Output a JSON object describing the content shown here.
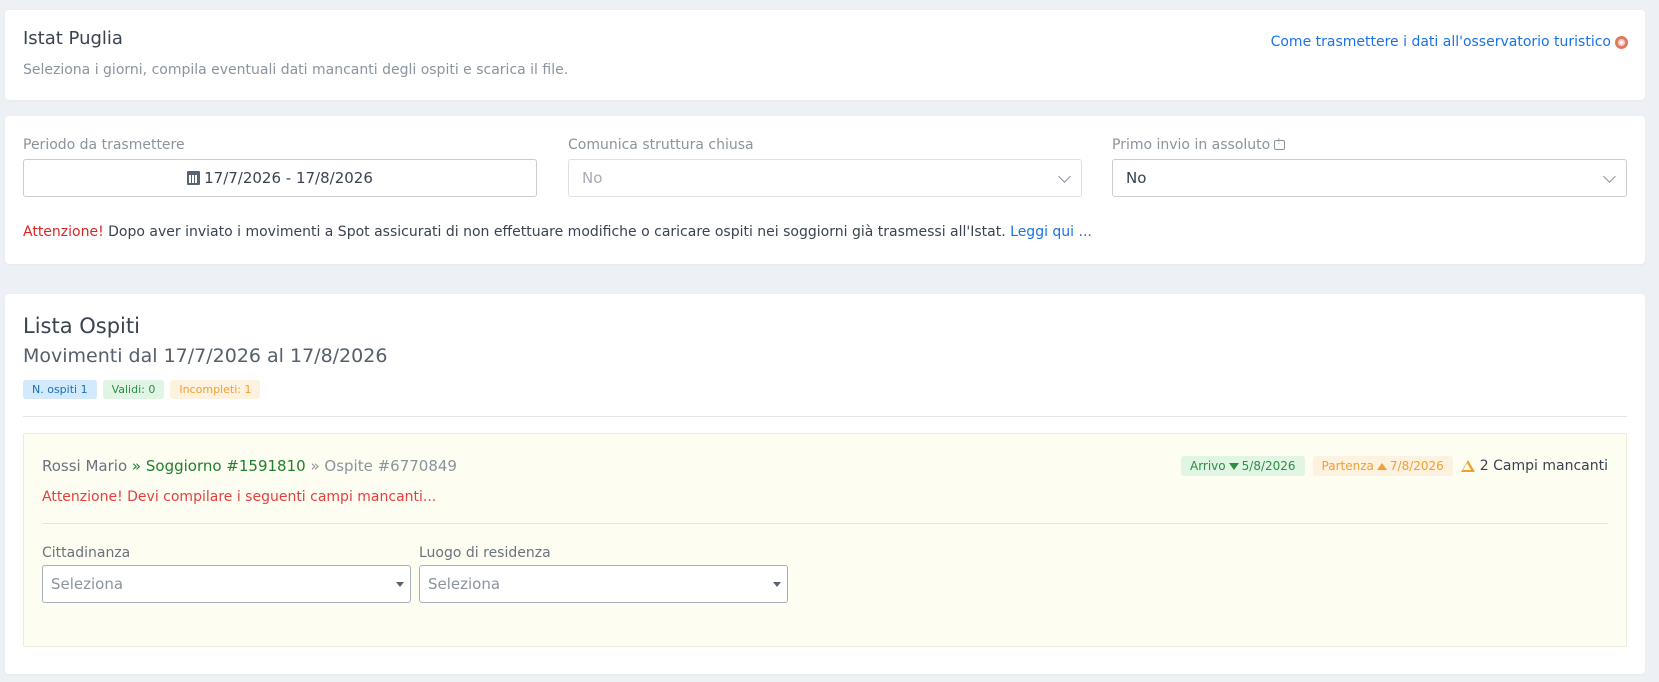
{
  "header": {
    "title": "Istat Puglia",
    "subtitle": "Seleziona i giorni, compila eventuali dati mancanti degli ospiti e scarica il file.",
    "help_link": "Come trasmettere i dati all'osservatorio turistico",
    "help_icon": "lifebuoy-icon"
  },
  "filters": {
    "period": {
      "label": "Periodo da trasmettere",
      "value": "17/7/2026 - 17/8/2026",
      "icon": "calendar-icon"
    },
    "closed": {
      "label": "Comunica struttura chiusa",
      "value": "No"
    },
    "first_send": {
      "label": "Primo invio in assoluto",
      "value": "No",
      "icon": "comment-icon"
    },
    "warning_strong": "Attenzione!",
    "warning_text": "Dopo aver inviato i movimenti a Spot assicurati di non effettuare modifiche o caricare ospiti nei soggiorni già trasmessi all'Istat.",
    "warning_link": "Leggi qui ..."
  },
  "guests": {
    "title": "Lista Ospiti",
    "subtitle": "Movimenti dal 17/7/2026 al 17/8/2026",
    "badges": {
      "count": "N. ospiti 1",
      "valid": "Validi: 0",
      "incomplete": "Incompleti: 1"
    },
    "colors": {
      "blue": "#1c6fb5",
      "green": "#2e8c44",
      "orange": "#f0a030",
      "red": "#e53e3e"
    },
    "item": {
      "name": "Rossi Mario",
      "stay": "» Soggiorno #1591810",
      "host": "» Ospite #6770849",
      "arrival_label": "Arrivo",
      "arrival_date": "5/8/2026",
      "departure_label": "Partenza",
      "departure_date": "7/8/2026",
      "missing": "2 Campi mancanti",
      "alert": "Attenzione! Devi compilare i seguenti campi mancanti...",
      "fields": {
        "citizenship": {
          "label": "Cittadinanza",
          "placeholder": "Seleziona"
        },
        "residence": {
          "label": "Luogo di residenza",
          "placeholder": "Seleziona"
        }
      }
    }
  }
}
